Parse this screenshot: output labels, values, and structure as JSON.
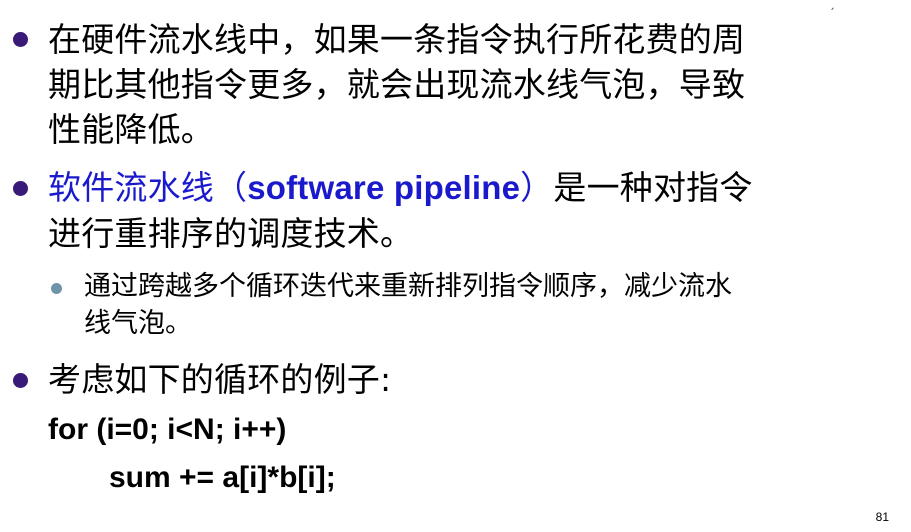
{
  "corner_mark": "ˏ",
  "bullets": [
    {
      "lines": [
        "在硬件流水线中，如果一条指令执行所花费的周",
        "期比其他指令更多，就会出现流水线气泡，导致",
        "性能降低。"
      ]
    },
    {
      "line1_prefix": "软件流水线（",
      "line1_en": "software pipeline",
      "line1_close": "）",
      "line1_rest": "是一种对指令",
      "line2": "进行重排序的调度技术。"
    },
    {
      "lines": [
        "考虑如下的循环的例子:"
      ]
    }
  ],
  "sub_bullet": {
    "lines": [
      "通过跨越多个循环迭代来重新排列指令顺序，减少流水",
      "线气泡。"
    ]
  },
  "code": {
    "line1": "for (i=0; i<N; i++)",
    "line2": "sum += a[i]*b[i];"
  },
  "page_number": "81",
  "colors": {
    "bullet": "#3a1a78",
    "sub_bullet": "#6f94a8",
    "highlight": "#1a1acc",
    "text": "#000000"
  }
}
